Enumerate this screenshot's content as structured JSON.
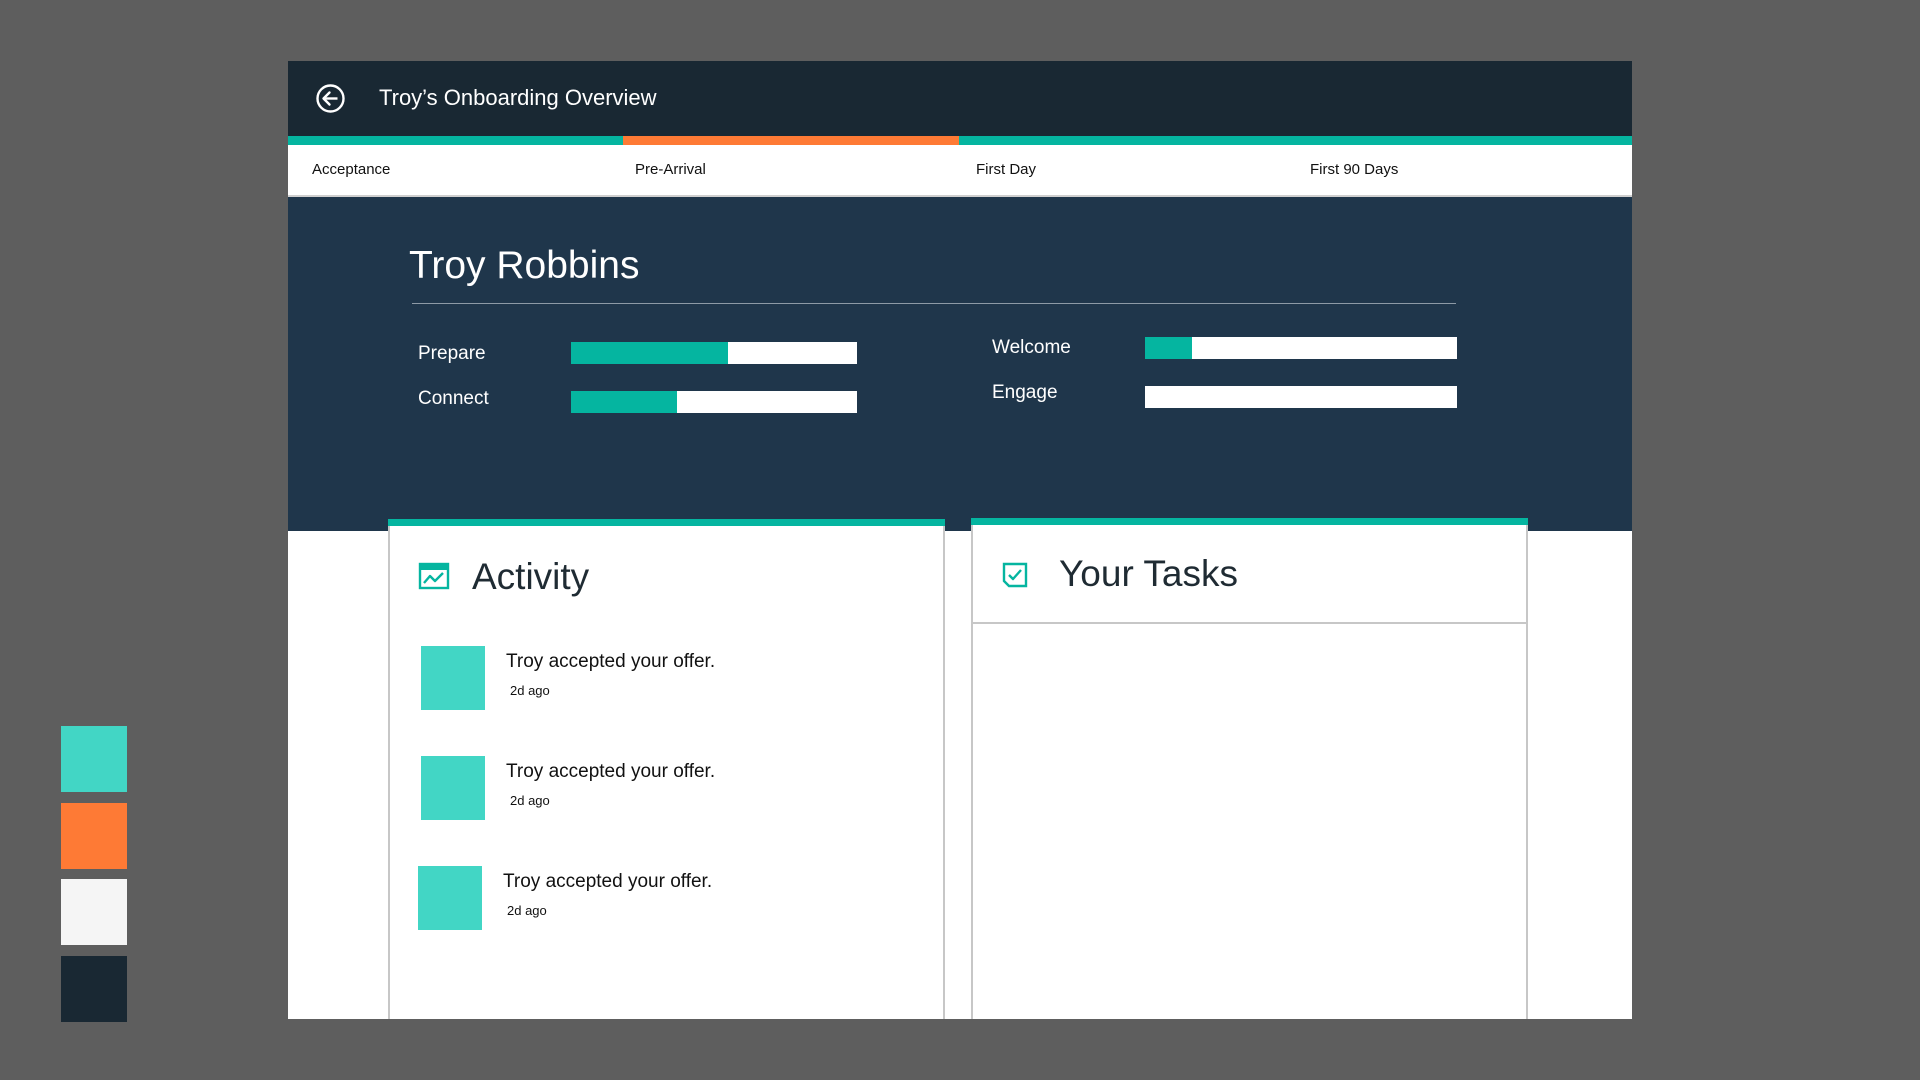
{
  "app": {
    "title": "Troy’s Onboarding Overview"
  },
  "colors": {
    "teal": "#05b5a0",
    "teal_light": "#42d6c5",
    "orange": "#fe7a35",
    "navy_dark": "#192833",
    "navy": "#1f364b",
    "off_white": "#f5f5f5"
  },
  "steps": {
    "active_index": 1,
    "tabs": [
      {
        "label": "Acceptance"
      },
      {
        "label": "Pre-Arrival"
      },
      {
        "label": "First Day"
      },
      {
        "label": "First 90 Days"
      }
    ]
  },
  "profile": {
    "name": "Troy Robbins",
    "metrics": [
      {
        "label": "Prepare",
        "progress": 0.55
      },
      {
        "label": "Connect",
        "progress": 0.37
      },
      {
        "label": "Welcome",
        "progress": 0.15
      },
      {
        "label": "Engage",
        "progress": 0.0
      }
    ]
  },
  "activity": {
    "title": "Activity",
    "icon": "activity-chart-icon",
    "items": [
      {
        "text": "Troy accepted your offer.",
        "time": "2d ago"
      },
      {
        "text": "Troy accepted your offer.",
        "time": "2d ago"
      },
      {
        "text": "Troy accepted your offer.",
        "time": "2d ago"
      }
    ]
  },
  "tasks": {
    "title": "Your Tasks",
    "icon": "checkbox-icon"
  },
  "palette": [
    "#42d6c5",
    "#fe7a35",
    "#f5f5f5",
    "#192833"
  ]
}
